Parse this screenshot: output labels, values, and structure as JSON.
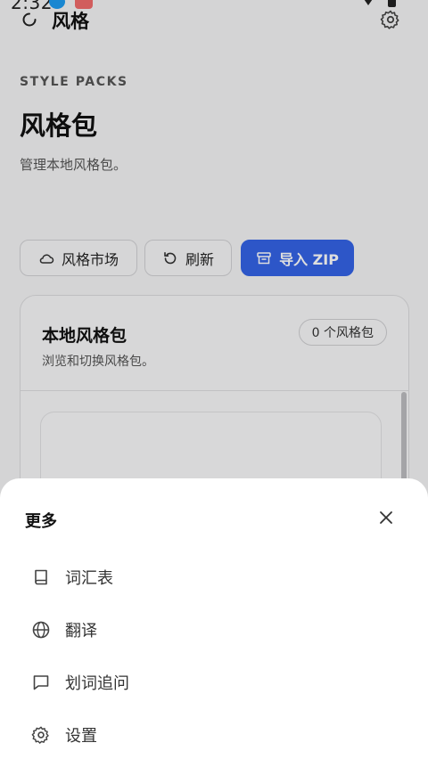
{
  "status_bar": {
    "time": "2:32"
  },
  "app_bar": {
    "title": "风格"
  },
  "header": {
    "eyebrow": "STYLE PACKS",
    "title": "风格包",
    "subtitle": "管理本地风格包。"
  },
  "actions": {
    "market": "风格市场",
    "refresh": "刷新",
    "import_zip": "导入 ZIP"
  },
  "local_card": {
    "title": "本地风格包",
    "subtitle": "浏览和切换风格包。",
    "count_badge": "0 个风格包"
  },
  "sheet": {
    "title": "更多",
    "items": [
      {
        "label": "词汇表",
        "icon": "book-icon"
      },
      {
        "label": "翻译",
        "icon": "globe-icon"
      },
      {
        "label": "划词追问",
        "icon": "chat-bubble-icon"
      },
      {
        "label": "设置",
        "icon": "gear-icon"
      }
    ]
  },
  "colors": {
    "accent": "#3463e6",
    "background": "#f4f4f5",
    "sheet": "#ffffff"
  }
}
